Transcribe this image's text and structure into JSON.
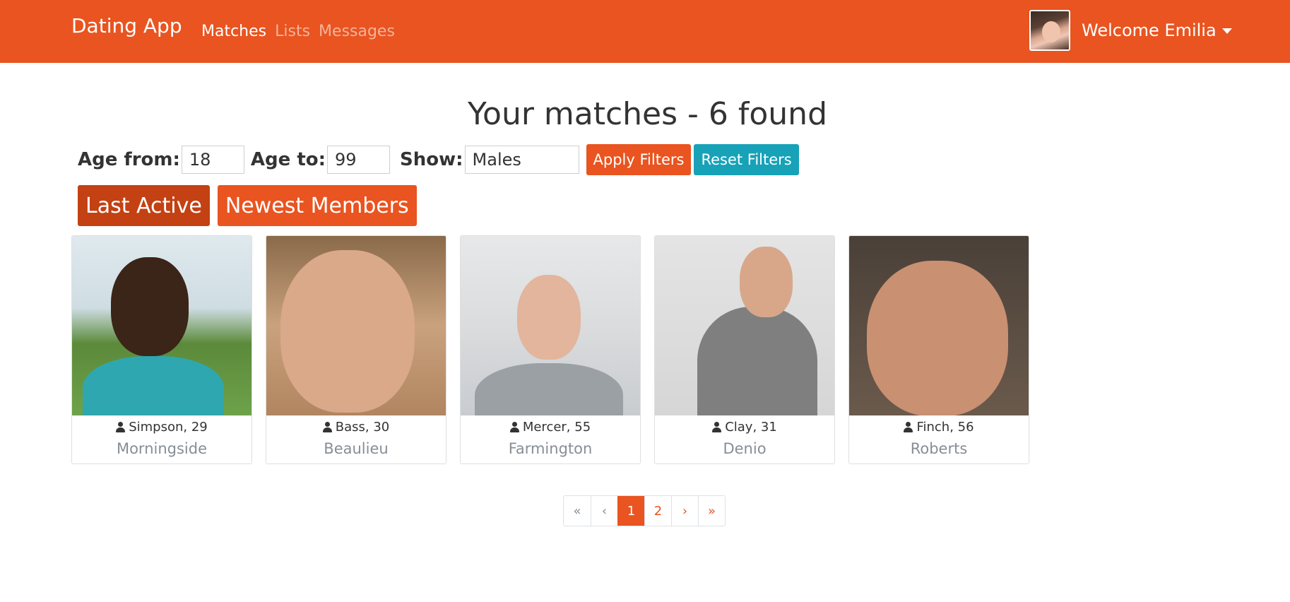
{
  "navbar": {
    "brand": "Dating App",
    "links": [
      "Matches",
      "Lists",
      "Messages"
    ],
    "welcome": "Welcome Emilia"
  },
  "main": {
    "title": "Your matches - 6 found"
  },
  "filters": {
    "age_from_label": "Age from:",
    "age_from_value": "18",
    "age_to_label": "Age to:",
    "age_to_value": "99",
    "show_label": "Show:",
    "show_value": "Males",
    "apply_label": "Apply Filters",
    "reset_label": "Reset Filters"
  },
  "sort": {
    "last_active": "Last Active",
    "newest": "Newest Members"
  },
  "matches": [
    {
      "name": "Simpson, 29",
      "city": "Morningside"
    },
    {
      "name": "Bass, 30",
      "city": "Beaulieu"
    },
    {
      "name": "Mercer, 55",
      "city": "Farmington"
    },
    {
      "name": "Clay, 31",
      "city": "Denio"
    },
    {
      "name": "Finch, 56",
      "city": "Roberts"
    }
  ],
  "pagination": {
    "first": "«",
    "prev": "‹",
    "pages": [
      "1",
      "2"
    ],
    "current": "1",
    "next": "›",
    "last": "»"
  },
  "colors": {
    "primary": "#e95420",
    "primary_dark": "#c34113",
    "info": "#17a2b8"
  }
}
